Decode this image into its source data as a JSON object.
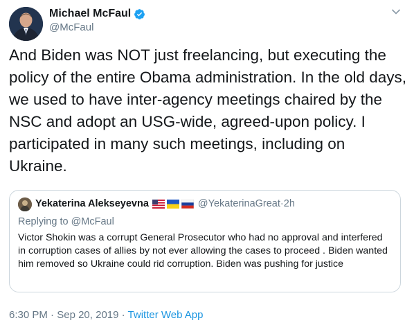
{
  "author": {
    "name": "Michael McFaul",
    "handle": "@McFaul",
    "verified": true
  },
  "tweet_text": "And Biden was NOT just freelancing, but executing the policy of the entire Obama administration.  In the old days, we used to have inter-agency meetings chaired by the NSC and adopt an USG-wide, agreed-upon policy. I participated in many such meetings, including on Ukraine.",
  "quoted": {
    "name": "Yekaterina Alekseyevna",
    "flags": [
      "us-flag",
      "ukraine-flag",
      "russia-flag"
    ],
    "handle": "@YekaterinaGreat",
    "separator": " · ",
    "age": "2h",
    "replying_to": "Replying to @McFaul",
    "text": "Victor Shokin was a corrupt General Prosecutor who had no approval and interfered in corruption cases of allies by not ever allowing the cases to proceed . Biden wanted him removed so Ukraine could rid corruption. Biden was pushing for justice"
  },
  "footer": {
    "time": "6:30 PM",
    "sep1": " · ",
    "date": "Sep 20, 2019",
    "sep2": " · ",
    "source": "Twitter Web App"
  },
  "colors": {
    "verified": "#1da1f2",
    "secondary_text": "#657786",
    "link": "#1b95e0",
    "border": "#ccd6dd"
  }
}
